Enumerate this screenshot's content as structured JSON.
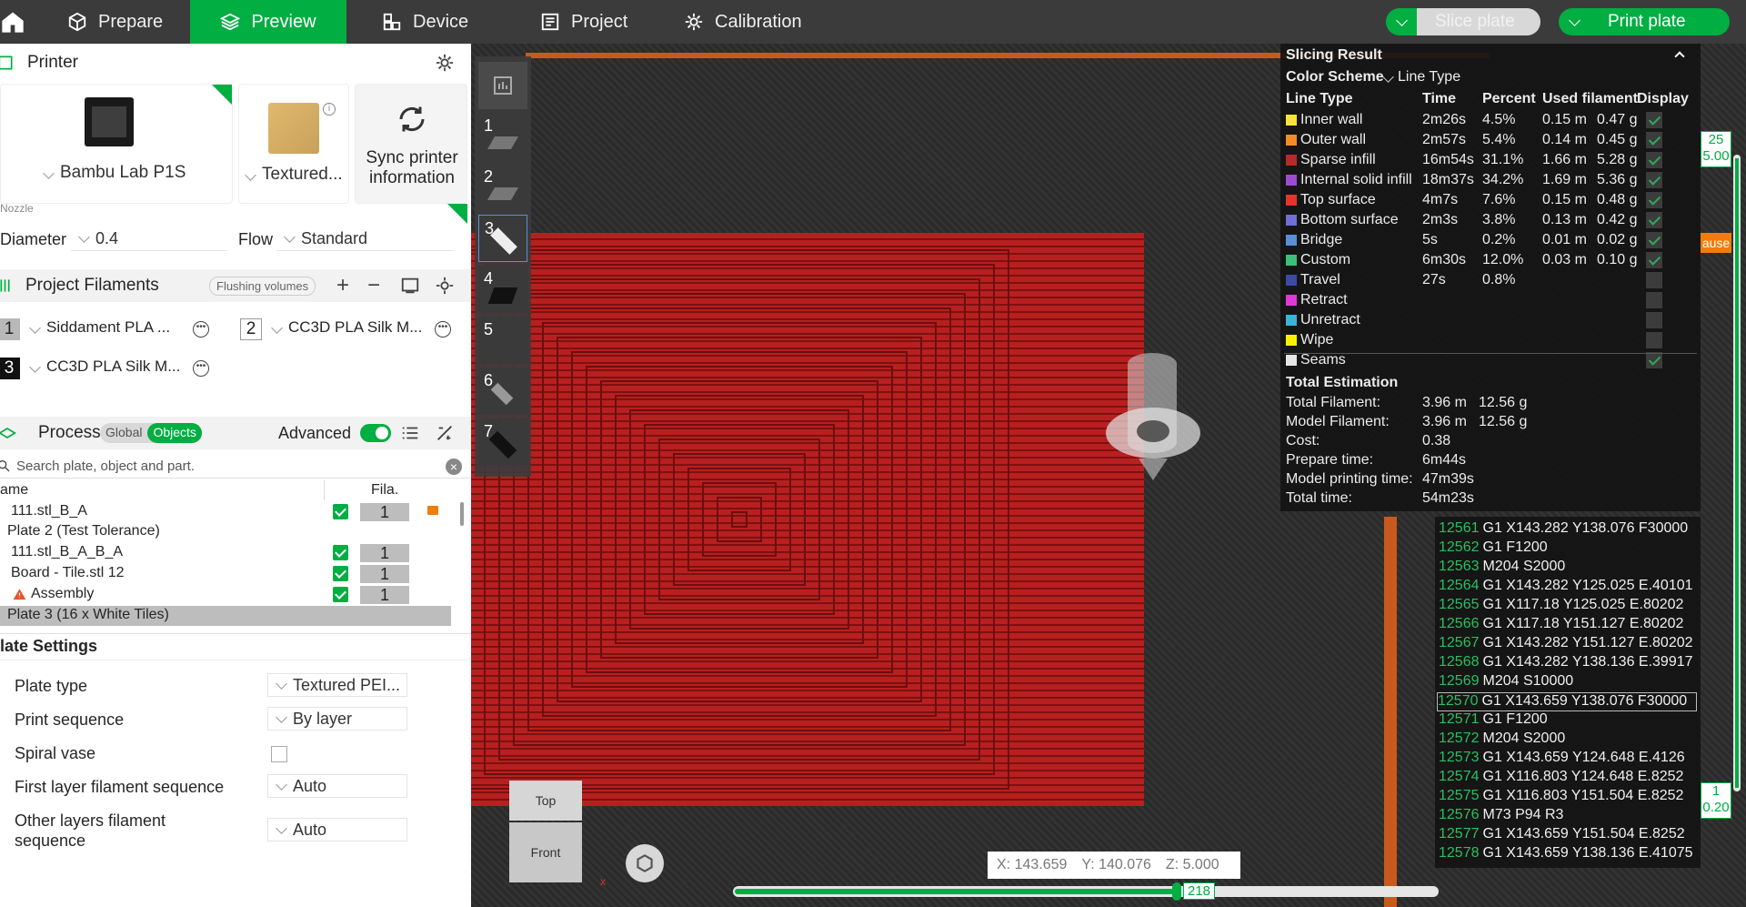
{
  "topbar": {
    "tabs": [
      {
        "label": "Prepare",
        "icon": "cube-icon"
      },
      {
        "label": "Preview",
        "icon": "layers-icon",
        "active": true
      },
      {
        "label": "Device",
        "icon": "device-icon"
      },
      {
        "label": "Project",
        "icon": "project-icon"
      },
      {
        "label": "Calibration",
        "icon": "gear-icon"
      }
    ],
    "slice_plate": "Slice plate",
    "print_plate": "Print plate",
    "accent": "#00ae42"
  },
  "printer": {
    "section_title": "Printer",
    "printer_name": "Bambu Lab P1S",
    "plate_type": "Textured...",
    "sync_line1": "Sync printer",
    "sync_line2": "information",
    "nozzle_label": "Nozzle",
    "diameter_label": "Diameter",
    "diameter_value": "0.4",
    "flow_label": "Flow",
    "flow_value": "Standard"
  },
  "filaments": {
    "section_title": "Project Filaments",
    "flushing_label": "Flushing volumes",
    "items": [
      {
        "num": "1",
        "name": "Siddament PLA ...",
        "color": "#b8b8b8"
      },
      {
        "num": "2",
        "name": "CC3D PLA Silk M...",
        "color": "#ffffff"
      },
      {
        "num": "3",
        "name": "CC3D PLA Silk M...",
        "color": "#111111"
      }
    ]
  },
  "process": {
    "section_title": "Process",
    "global_label": "Global",
    "objects_label": "Objects",
    "advanced_label": "Advanced",
    "search_placeholder": "Search plate, object and part.",
    "col_name": "ame",
    "col_fila": "Fila.",
    "tree": [
      {
        "label": "111.stl_B_A",
        "fila": "1",
        "checked": true,
        "lock": true
      },
      {
        "label": "Plate 2 (Test Tolerance)",
        "plate": true
      },
      {
        "label": "111.stl_B_A_B_A",
        "fila": "1",
        "checked": true
      },
      {
        "label": "Board - Tile.stl 12",
        "fila": "1",
        "checked": true
      },
      {
        "label": "Assembly",
        "fila": "1",
        "checked": true,
        "warn": true
      },
      {
        "label": "Plate 3 (16 x White Tiles)",
        "plate": true,
        "selected": true
      }
    ]
  },
  "plate_settings": {
    "title": "late Settings",
    "rows": [
      {
        "label": "Plate type",
        "value": "Textured PEI..."
      },
      {
        "label": "Print sequence",
        "value": "By layer"
      },
      {
        "label": "Spiral vase",
        "value": ""
      },
      {
        "label": "First layer filament sequence",
        "value": "Auto"
      },
      {
        "label_line1": "Other layers filament",
        "label_line2": "sequence",
        "value": "Auto"
      }
    ]
  },
  "layers": {
    "items": [
      "1",
      "2",
      "3",
      "4",
      "5",
      "6",
      "7"
    ]
  },
  "slicing": {
    "title": "Slicing Result",
    "color_scheme_label": "Color Scheme",
    "color_scheme_value": "Line Type",
    "headers": [
      "Line Type",
      "Time",
      "Percent",
      "Used filament",
      "Display"
    ],
    "lines": [
      {
        "name": "Inner wall",
        "color": "#f5e33a",
        "time": "2m26s",
        "pct": "4.5%",
        "len": "0.15 m",
        "wt": "0.47 g",
        "on": true
      },
      {
        "name": "Outer wall",
        "color": "#f28c28",
        "time": "2m57s",
        "pct": "5.4%",
        "len": "0.14 m",
        "wt": "0.45 g",
        "on": true
      },
      {
        "name": "Sparse infill",
        "color": "#b52a2a",
        "time": "16m54s",
        "pct": "31.1%",
        "len": "1.66 m",
        "wt": "5.28 g",
        "on": true
      },
      {
        "name": "Internal solid infill",
        "color": "#9b4cd1",
        "time": "18m37s",
        "pct": "34.2%",
        "len": "1.69 m",
        "wt": "5.36 g",
        "on": true
      },
      {
        "name": "Top surface",
        "color": "#e8322c",
        "time": "4m7s",
        "pct": "7.6%",
        "len": "0.15 m",
        "wt": "0.48 g",
        "on": true
      },
      {
        "name": "Bottom surface",
        "color": "#6f6fd6",
        "time": "2m3s",
        "pct": "3.8%",
        "len": "0.13 m",
        "wt": "0.42 g",
        "on": true
      },
      {
        "name": "Bridge",
        "color": "#5b8ed6",
        "time": "5s",
        "pct": "0.2%",
        "len": "0.01 m",
        "wt": "0.02 g",
        "on": true
      },
      {
        "name": "Custom",
        "color": "#3cc07a",
        "time": "6m30s",
        "pct": "12.0%",
        "len": "0.03 m",
        "wt": "0.10 g",
        "on": true
      },
      {
        "name": "Travel",
        "color": "#3b4aa6",
        "time": "27s",
        "pct": "0.8%",
        "len": "",
        "wt": "",
        "on": false
      },
      {
        "name": "Retract",
        "color": "#e03ad6",
        "time": "",
        "pct": "",
        "len": "",
        "wt": "",
        "on": false
      },
      {
        "name": "Unretract",
        "color": "#38b6d8",
        "time": "",
        "pct": "",
        "len": "",
        "wt": "",
        "on": false
      },
      {
        "name": "Wipe",
        "color": "#f8f000",
        "time": "",
        "pct": "",
        "len": "",
        "wt": "",
        "on": false
      },
      {
        "name": "Seams",
        "color": "#e6e6e6",
        "time": "",
        "pct": "",
        "len": "",
        "wt": "",
        "on": true
      }
    ],
    "total_title": "Total Estimation",
    "totals": [
      {
        "label": "Total Filament:",
        "a": "3.96 m",
        "b": "12.56 g"
      },
      {
        "label": "Model Filament:",
        "a": "3.96 m",
        "b": "12.56 g"
      },
      {
        "label": "Cost:",
        "a": "0.38",
        "b": ""
      },
      {
        "label": "Prepare time:",
        "a": "6m44s",
        "b": ""
      },
      {
        "label": "Model printing time:",
        "a": "47m39s",
        "b": ""
      },
      {
        "label": "Total time:",
        "a": "54m23s",
        "b": ""
      }
    ]
  },
  "gcode": [
    {
      "n": "12561",
      "t": "G1 X143.282 Y138.076 F30000"
    },
    {
      "n": "12562",
      "t": "G1 F1200"
    },
    {
      "n": "12563",
      "t": "M204 S2000"
    },
    {
      "n": "12564",
      "t": "G1 X143.282 Y125.025 E.40101"
    },
    {
      "n": "12565",
      "t": "G1 X117.18 Y125.025 E.80202"
    },
    {
      "n": "12566",
      "t": "G1 X117.18 Y151.127 E.80202"
    },
    {
      "n": "12567",
      "t": "G1 X143.282 Y151.127 E.80202"
    },
    {
      "n": "12568",
      "t": "G1 X143.282 Y138.136 E.39917"
    },
    {
      "n": "12569",
      "t": "M204 S10000"
    },
    {
      "n": "12570",
      "t": "G1 X143.659 Y138.076 F30000"
    },
    {
      "n": "12571",
      "t": "G1 F1200"
    },
    {
      "n": "12572",
      "t": "M204 S2000"
    },
    {
      "n": "12573",
      "t": "G1 X143.659 Y124.648 E.4126"
    },
    {
      "n": "12574",
      "t": "G1 X116.803 Y124.648 E.8252"
    },
    {
      "n": "12575",
      "t": "G1 X116.803 Y151.504 E.8252"
    },
    {
      "n": "12576",
      "t": "M73 P94 R3"
    },
    {
      "n": "12577",
      "t": "G1 X143.659 Y151.504 E.8252"
    },
    {
      "n": "12578",
      "t": "G1 X143.659 Y138.136 E.41075"
    }
  ],
  "vertical_slider": {
    "top_layer": "25",
    "top_height": "5.00",
    "bottom_layer": "1",
    "bottom_height": "0.20",
    "pause_label": "ause"
  },
  "horizontal_slider": {
    "value": "218",
    "fraction": 0.63
  },
  "coords": {
    "x": "X: 143.659",
    "y": "Y: 140.076",
    "z": "Z: 5.000"
  },
  "view_cube": {
    "top": "Top",
    "front": "Front",
    "x_axis": "x"
  }
}
